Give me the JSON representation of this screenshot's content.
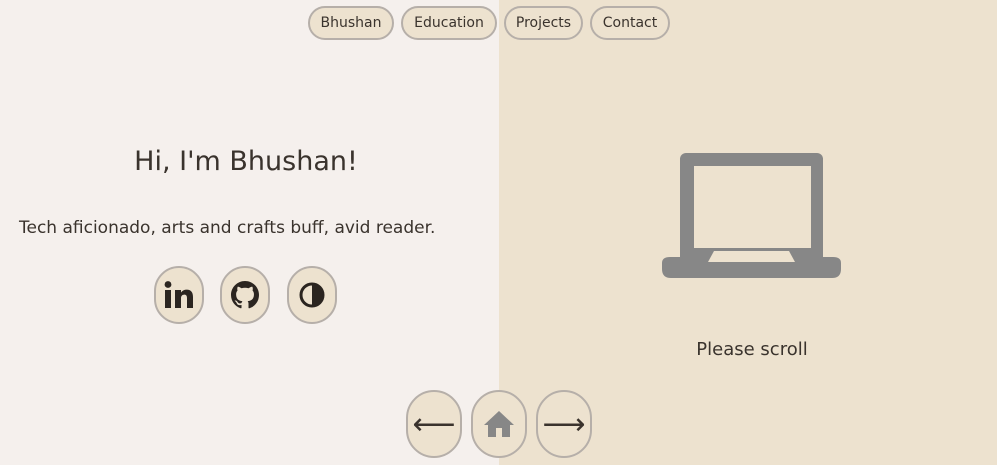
{
  "nav": {
    "items": [
      {
        "label": "Bhushan"
      },
      {
        "label": "Education"
      },
      {
        "label": "Projects"
      },
      {
        "label": "Contact"
      }
    ]
  },
  "hero": {
    "heading": "Hi, I'm Bhushan!",
    "tagline": "Tech aficionado, arts and crafts buff, avid reader."
  },
  "social": {
    "icons": [
      "linkedin-icon",
      "github-icon",
      "theme-toggle-icon"
    ]
  },
  "right_panel": {
    "icon": "laptop-icon",
    "scroll_hint": "Please scroll"
  },
  "footer_nav": {
    "prev_glyph": "⟵",
    "home_icon": "home-icon",
    "next_glyph": "⟶"
  },
  "colors": {
    "left_bg": "#f5f0ed",
    "right_bg": "#ede2cf",
    "button_bg": "#ede2cf",
    "button_border": "#b6afa9",
    "text": "#3a332d",
    "icon_gray": "#878787"
  }
}
